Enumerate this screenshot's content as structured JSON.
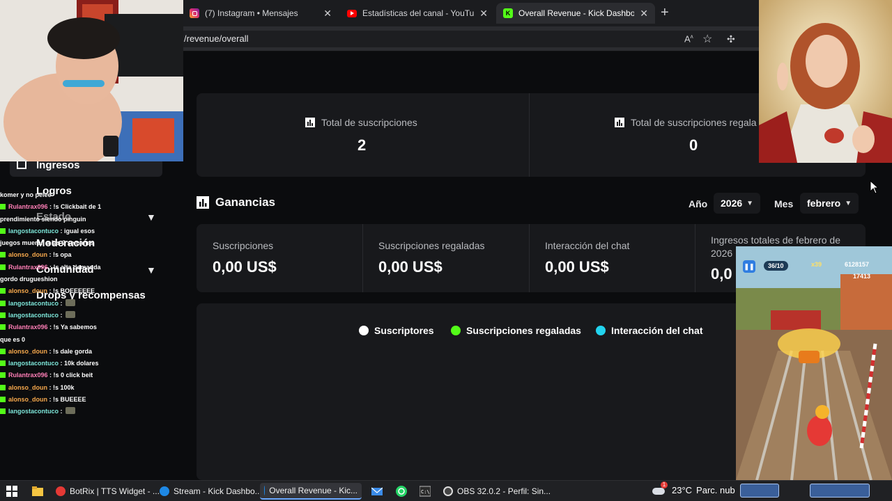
{
  "browser": {
    "tabs": [
      {
        "label": "(7) Instagram • Mensajes",
        "favicon": "instagram-icon",
        "color": "#e1306c",
        "active": false
      },
      {
        "label": "Estadísticas del canal - YouTube St",
        "favicon": "youtube-icon",
        "color": "#ff0000",
        "active": false
      },
      {
        "label": "Overall Revenue - Kick Dashboard",
        "favicon": "kick-icon",
        "color": "#53fc18",
        "active": true
      }
    ],
    "url": "/revenue/overall"
  },
  "sidebar": {
    "items": [
      {
        "label": "Ingresos"
      },
      {
        "label": "Logros"
      },
      {
        "label": "Estado"
      },
      {
        "label": "Moderación"
      },
      {
        "label": "Comunidad"
      },
      {
        "label": "Drops y recompensas"
      }
    ]
  },
  "stats": {
    "total_subs_label": "Total de suscripciones",
    "total_subs_value": "2",
    "gifted_subs_label": "Total de suscripciones regala",
    "gifted_subs_value": "0"
  },
  "earnings": {
    "title": "Ganancias",
    "year_label": "Año",
    "year_value": "2026",
    "month_label": "Mes",
    "month_value": "febrero",
    "cards": [
      {
        "label": "Suscripciones",
        "value": "0,00 US$"
      },
      {
        "label": "Suscripciones regaladas",
        "value": "0,00 US$"
      },
      {
        "label": "Interacción del chat",
        "value": "0,00 US$"
      },
      {
        "label": "Ingresos totales de febrero de 2026",
        "value": "0,0"
      }
    ]
  },
  "chart_data": {
    "type": "bar",
    "categories": [],
    "series": [
      {
        "name": "Suscriptores",
        "color": "#ffffff",
        "values": []
      },
      {
        "name": "Suscripciones regaladas",
        "color": "#53fc18",
        "values": []
      },
      {
        "name": "Interacción del chat",
        "color": "#22d3ee",
        "values": []
      }
    ],
    "legend": "top-center"
  },
  "chat": {
    "lines": [
      {
        "user": "",
        "text": "komer y no pelee",
        "color": "#ffffff",
        "kick": false
      },
      {
        "user": "Rulantrax096",
        "text": ": !s Clickbait de 1",
        "color": "#ff7eb6",
        "kick": true
      },
      {
        "user": "",
        "text": "prendimiento siendo pinguin",
        "color": "#ffffff",
        "kick": false
      },
      {
        "user": "langostacontuco",
        "text": ": igual esos",
        "color": "#7de5d8",
        "kick": true
      },
      {
        "user": "",
        "text": "juegos mueren a las 2 semanas",
        "color": "#ffffff",
        "kick": false
      },
      {
        "user": "alonso_doun",
        "text": ": !s opa",
        "color": "#f6a84c",
        "kick": true
      },
      {
        "user": "Rulantrax096",
        "text": ": !s alta demanda",
        "color": "#ff7eb6",
        "kick": true
      },
      {
        "user": "",
        "text": "gordo drugueshion",
        "color": "#ffffff",
        "kick": false
      },
      {
        "user": "alonso_doun",
        "text": ": !s BOEEEEEE",
        "color": "#f6a84c",
        "kick": true
      },
      {
        "user": "langostacontuco",
        "text": ":",
        "color": "#7de5d8",
        "kick": true
      },
      {
        "user": "langostacontuco",
        "text": ":",
        "color": "#7de5d8",
        "kick": true
      },
      {
        "user": "Rulantrax096",
        "text": ": !s Ya sabemos",
        "color": "#ff7eb6",
        "kick": true
      },
      {
        "user": "",
        "text": "que es 0",
        "color": "#ffffff",
        "kick": false
      },
      {
        "user": "alonso_doun",
        "text": ": !s dale gorda",
        "color": "#f6a84c",
        "kick": true
      },
      {
        "user": "langostacontuco",
        "text": ": 10k dolares",
        "color": "#7de5d8",
        "kick": true
      },
      {
        "user": "Rulantrax096",
        "text": ": !s 0 click beit",
        "color": "#ff7eb6",
        "kick": true
      },
      {
        "user": "alonso_doun",
        "text": ": !s 100k",
        "color": "#f6a84c",
        "kick": true
      },
      {
        "user": "alonso_doun",
        "text": ": !s BUEEEE",
        "color": "#f6a84c",
        "kick": true
      },
      {
        "user": "langostacontuco",
        "text": ":",
        "color": "#7de5d8",
        "kick": true
      }
    ]
  },
  "game_hud": {
    "progress": "36/10",
    "multiplier": "x39",
    "score": "6128157",
    "coins": "17413"
  },
  "taskbar": {
    "apps": [
      {
        "label": "BotRix | TTS Widget - ...",
        "icon": "botrix-icon",
        "color": "#e53935"
      },
      {
        "label": "Stream - Kick Dashbo...",
        "icon": "edge-icon",
        "color": "#1e88e5"
      },
      {
        "label": "Overall Revenue - Kic...",
        "icon": "edge-icon",
        "color": "#1e88e5",
        "active": true
      },
      {
        "label": "OBS 32.0.2 - Perfil: Sin...",
        "icon": "obs-icon",
        "color": "#444444"
      }
    ],
    "temperature": "23°C",
    "weather_text": "Parc. nub",
    "weather_badge": "1"
  }
}
